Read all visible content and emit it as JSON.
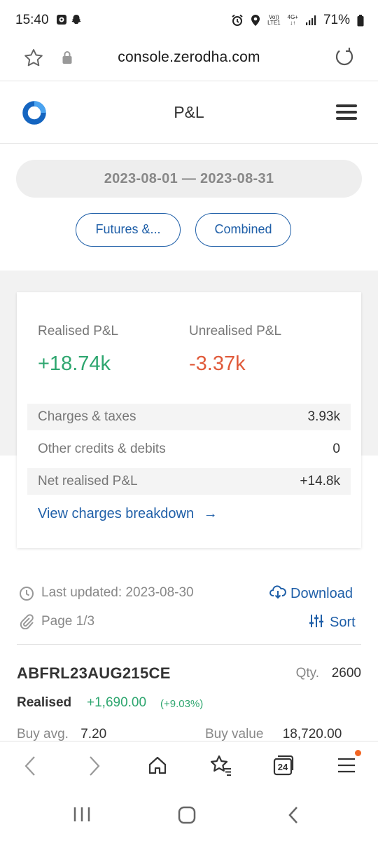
{
  "status_bar": {
    "time": "15:40",
    "network_top": "Vo))",
    "network_bottom": "LTE1",
    "net2_top": "4G+",
    "net2_bottom": "↓↑",
    "battery": "71%"
  },
  "browser": {
    "url": "console.zerodha.com",
    "tab_count": "24"
  },
  "header": {
    "title": "P&L"
  },
  "filters": {
    "date_range": "2023-08-01 — 2023-08-31",
    "segment_chip": "Futures &...",
    "mode_chip": "Combined"
  },
  "summary": {
    "realised_label": "Realised P&L",
    "realised_value": "+18.74k",
    "unrealised_label": "Unrealised P&L",
    "unrealised_value": "-3.37k",
    "rows": [
      {
        "label": "Charges & taxes",
        "value": "3.93k"
      },
      {
        "label": "Other credits & debits",
        "value": "0"
      },
      {
        "label": "Net realised P&L",
        "value": "+14.8k"
      }
    ],
    "breakdown_link": "View charges breakdown",
    "link_arrow": "→",
    "colors": {
      "positive": "#2ea66f",
      "negative": "#e05a3a",
      "link": "#1f5fa8"
    }
  },
  "meta": {
    "last_updated": "Last updated: 2023-08-30",
    "page": "Page 1/3",
    "download": "Download",
    "sort": "Sort"
  },
  "position": {
    "symbol": "ABFRL23AUG215CE",
    "qty_label": "Qty.",
    "qty": "2600",
    "realised_label": "Realised",
    "realised_value": "+1,690.00",
    "realised_pct": "(+9.03%)",
    "buy_avg_label": "Buy avg.",
    "buy_avg": "7.20",
    "buy_value_label": "Buy value",
    "buy_value": "18,720.00"
  }
}
